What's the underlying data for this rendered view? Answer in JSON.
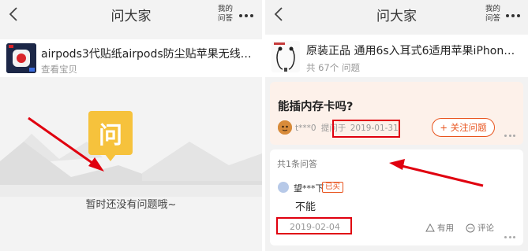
{
  "colors": {
    "accent": "#e8541e",
    "annotation_red": "#e0000f",
    "bubble_yellow": "#f6c23c"
  },
  "left": {
    "header": {
      "title": "问大家",
      "mine_line1": "我的",
      "mine_line2": "问答",
      "back_icon": "chevron-left-icon",
      "more_icon": "more-dots-icon"
    },
    "product": {
      "name": "airpods3代贴纸airpods防尘贴苹果无线蓝牙耳机...",
      "link": "查看宝贝"
    },
    "empty_state": {
      "icon_char": "问",
      "message": "暂时还没有问题哦~"
    }
  },
  "right": {
    "header": {
      "title": "问大家",
      "mine_line1": "我的",
      "mine_line2": "问答",
      "back_icon": "chevron-left-icon",
      "more_icon": "more-dots-icon"
    },
    "product": {
      "name": "原装正品 通用6s入耳式6适用苹果iPhone...",
      "question_count": "共 67个 问题"
    },
    "question": {
      "title": "能插内存卡吗?",
      "asker": "t***0",
      "asked_label": "提问于",
      "asked_date": "2019-01-31",
      "follow_button": "+ 关注问题"
    },
    "answers": {
      "count_label": "共1条问答",
      "items": [
        {
          "user": "望***下",
          "badge": "已买",
          "text": "不能",
          "date": "2019-02-04",
          "useful_label": "有用",
          "comment_label": "评论"
        }
      ]
    }
  }
}
